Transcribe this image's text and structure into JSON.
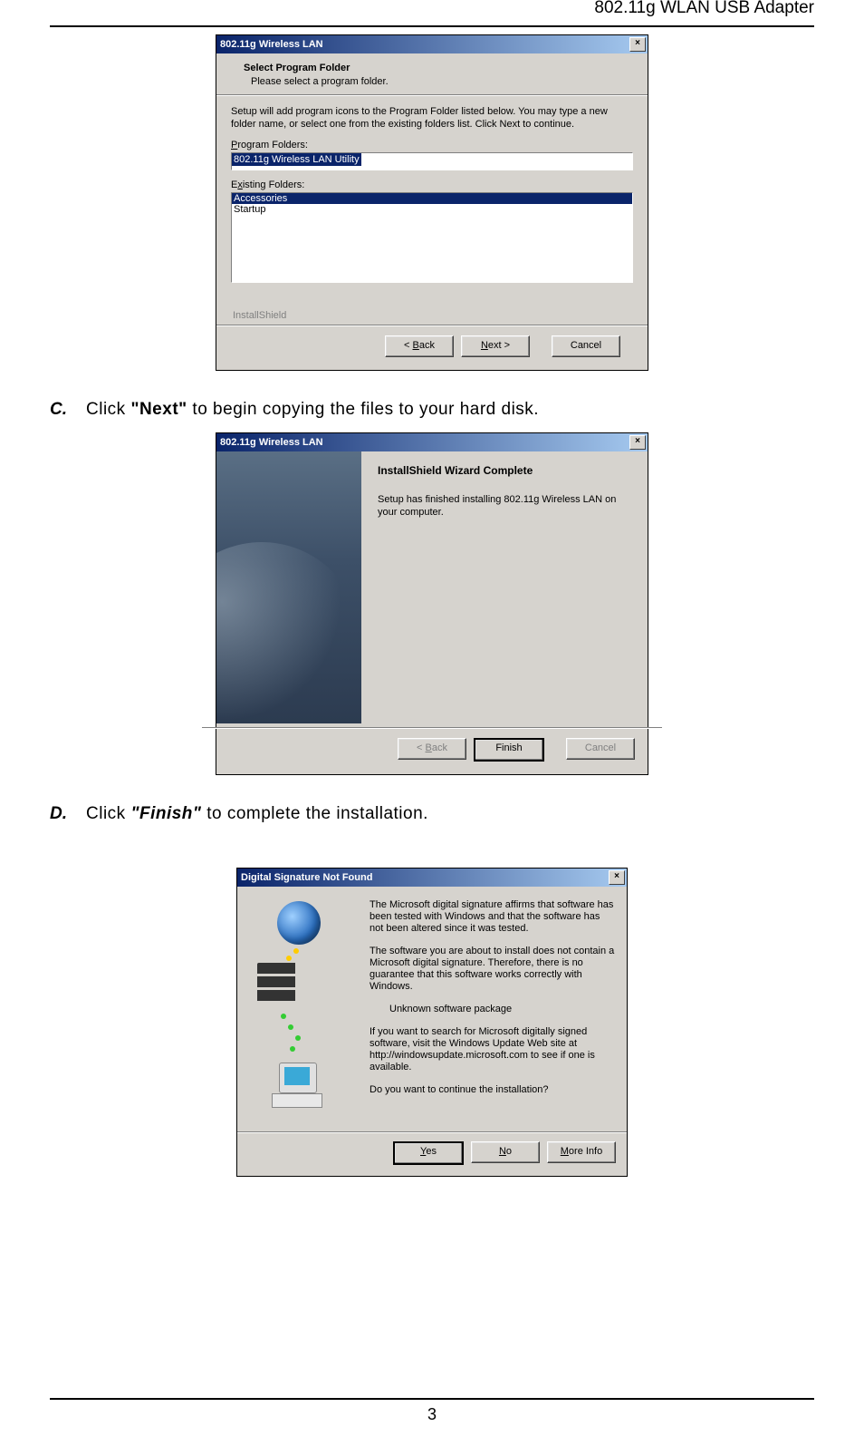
{
  "header": "802.11g WLAN USB Adapter",
  "page_number": "3",
  "dialog1": {
    "title": "802.11g Wireless LAN",
    "heading": "Select Program Folder",
    "subheading": "Please select a program folder.",
    "instruction": "Setup will add program icons to the Program Folder listed below.  You may type a new folder name, or select one from the existing folders list.  Click Next to continue.",
    "label_program_folders": "Program Folders:",
    "program_folder_value": "802.11g Wireless LAN Utility",
    "label_existing_folders": "Existing Folders:",
    "existing_folders": {
      "hl": "Accessories",
      "row": "Startup"
    },
    "brand": "InstallShield",
    "buttons": {
      "back": "< Back",
      "next": "Next >",
      "cancel": "Cancel"
    }
  },
  "step_c": {
    "letter": "C.",
    "pre": "Click ",
    "bold": "\"Next\"",
    "post": " to begin copying the files to your hard disk."
  },
  "dialog2": {
    "title": "802.11g Wireless LAN",
    "heading": "InstallShield Wizard Complete",
    "text": "Setup has finished installing 802.11g Wireless LAN on your computer.",
    "buttons": {
      "back": "< Back",
      "finish": "Finish",
      "cancel": "Cancel"
    }
  },
  "step_d": {
    "letter": "D.",
    "pre": "Click ",
    "bold": "\"Finish\"",
    "post": " to complete the installation."
  },
  "dialog3": {
    "title": "Digital Signature Not Found",
    "p1": "The Microsoft digital signature affirms that software has been tested with Windows and that the software has not been altered since it was tested.",
    "p2": "The software you are about to install does not contain a Microsoft digital signature. Therefore,  there is no guarantee that this software works correctly with Windows.",
    "pkg": "Unknown software package",
    "p3": "If you want to search for Microsoft digitally signed software, visit the Windows Update Web site at http://windowsupdate.microsoft.com to see if one is available.",
    "p4": "Do you want to continue the installation?",
    "buttons": {
      "yes_pre": "",
      "yes_u": "Y",
      "yes_post": "es",
      "no_u": "N",
      "no_post": "o",
      "more_u": "M",
      "more_post": "ore Info"
    }
  }
}
